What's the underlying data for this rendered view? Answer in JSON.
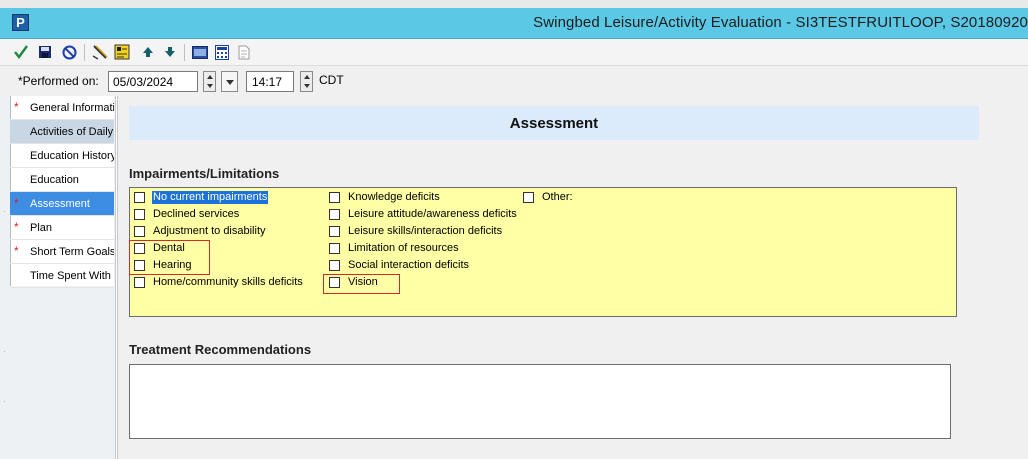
{
  "window": {
    "app_icon_letter": "P",
    "title": "Swingbed Leisure/Activity Evaluation - SI3TESTFRUITLOOP, S20180920"
  },
  "toolbar": {
    "icons": [
      "checkmark-icon",
      "save-icon",
      "cancel-icon",
      "pencil-icon",
      "form-icon",
      "arrow-up-icon",
      "arrow-down-icon",
      "keyboard-icon",
      "calculator-icon",
      "print-icon"
    ]
  },
  "performed": {
    "label": "*Performed on:",
    "date": "05/03/2024",
    "time": "14:17",
    "timezone": "CDT"
  },
  "sidebar": {
    "items": [
      {
        "label": "General Information",
        "required": true,
        "state": "normal"
      },
      {
        "label": "Activities of Daily",
        "required": false,
        "state": "gray"
      },
      {
        "label": "Education History",
        "required": false,
        "state": "normal"
      },
      {
        "label": "Education",
        "required": false,
        "state": "normal"
      },
      {
        "label": "Assessment",
        "required": true,
        "state": "selected"
      },
      {
        "label": "Plan",
        "required": true,
        "state": "normal"
      },
      {
        "label": "Short Term Goals",
        "required": true,
        "state": "normal"
      },
      {
        "label": "Time Spent With",
        "required": false,
        "state": "normal"
      }
    ]
  },
  "main": {
    "section_title": "Assessment",
    "impairments_label": "Impairments/Limitations",
    "impairments_col1": [
      "No current impairments",
      "Declined services",
      "Adjustment to disability",
      "Dental",
      "Hearing",
      "Home/community skills deficits"
    ],
    "impairments_col2": [
      "Knowledge deficits",
      "Leisure attitude/awareness deficits",
      "Leisure skills/interaction deficits",
      "Limitation of resources",
      "Social interaction deficits",
      "Vision"
    ],
    "impairments_col3": [
      "Other:"
    ],
    "treatment_label": "Treatment Recommendations",
    "treatment_value": ""
  },
  "colors": {
    "titlebar": "#5bc8e6",
    "selected": "#3d8ee3",
    "required_star": "#e0202a",
    "impairments_bg": "#ffffa6",
    "highlight_box": "#d42a2a",
    "header_band": "#dcebfb"
  }
}
